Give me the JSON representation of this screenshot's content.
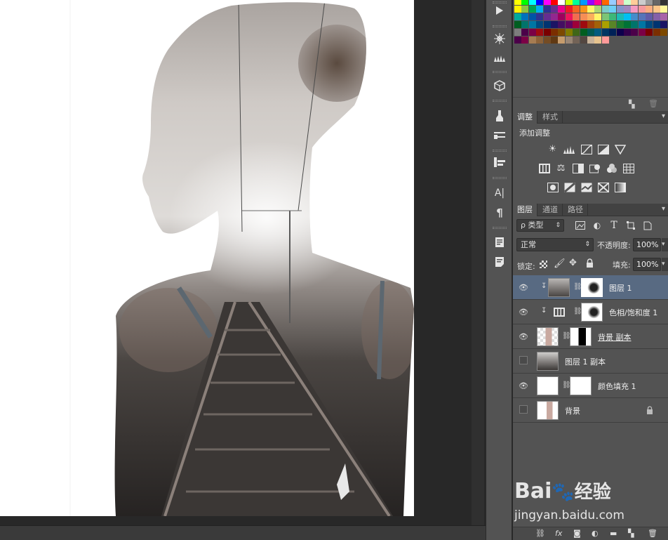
{
  "swatch_rows": [
    [
      "#ffff00",
      "#00ff00",
      "#00ffff",
      "#0000ff",
      "#ff00ff",
      "#ff0000",
      "#ffffff",
      "#ccff00",
      "#00ff99",
      "#0099ff",
      "#9900ff",
      "#ff0099",
      "#ff6600",
      "#99ccff",
      "#ff9999",
      "#ccffcc",
      "#ffcc99",
      "#cccccc",
      "#999999",
      "#666666",
      "#333333"
    ],
    [
      "#fff200",
      "#8dc63f",
      "#00a651",
      "#00aeef",
      "#2e3192",
      "#662d91",
      "#ec008c",
      "#ed1c24",
      "#f26522",
      "#f7941d",
      "#fff568",
      "#acd373",
      "#7accc8",
      "#6dcff6",
      "#8393ca",
      "#a186be",
      "#f49ac1",
      "#f5989d",
      "#f9ad81",
      "#fdc689",
      "#fff799"
    ],
    [
      "#00a99d",
      "#0072bc",
      "#0054a6",
      "#2e3192",
      "#662d91",
      "#92278f",
      "#9e005d",
      "#ed145b",
      "#f26c4f",
      "#f68e56",
      "#fbaf5d",
      "#fff467",
      "#7cc576",
      "#3cb878",
      "#1cbbb4",
      "#00bff3",
      "#448ccb",
      "#5674b9",
      "#605ca8",
      "#8560a8",
      "#a864a8"
    ],
    [
      "#005e20",
      "#00746b",
      "#0076a3",
      "#004a80",
      "#003471",
      "#1b1464",
      "#440e62",
      "#630460",
      "#9e0039",
      "#9e0b0f",
      "#a0410d",
      "#a36209",
      "#aba000",
      "#598527",
      "#197b30",
      "#007236",
      "#00746b",
      "#0076a3",
      "#004a80",
      "#003471",
      "#1b1464"
    ],
    [
      "#7d7d7d",
      "#4b0049",
      "#7b0046",
      "#9e0b0f",
      "#790000",
      "#7b2e00",
      "#7d4900",
      "#827b00",
      "#406618",
      "#005e20",
      "#005952",
      "#005b7f",
      "#003663",
      "#002157",
      "#0d004c",
      "#32004b",
      "#4b0049",
      "#7b0046",
      "#790000",
      "#7b2e00",
      "#7d4900"
    ],
    [
      "#4b0049",
      "#7b0046",
      "#a67c52",
      "#8c6239",
      "#754c24",
      "#603913",
      "#c69c6d",
      "#998675",
      "#736357",
      "#534741",
      "#c7b299",
      "#e6c38e",
      "#ff9999"
    ]
  ],
  "adjustments_panel": {
    "tabs": [
      "调整",
      "样式"
    ],
    "title": "添加调整"
  },
  "layers_panel": {
    "tabs": [
      "图层",
      "通道",
      "路径"
    ],
    "filter_label": "ρ 类型",
    "blend_mode": "正常",
    "opacity_label": "不透明度:",
    "opacity_value": "100%",
    "lock_label": "锁定:",
    "fill_label": "填充:",
    "fill_value": "100%",
    "layers": [
      {
        "name": "图层 1",
        "visible": true,
        "selected": true
      },
      {
        "name": "色相/饱和度 1",
        "visible": true,
        "selected": false
      },
      {
        "name": "背景 副本",
        "visible": true,
        "selected": false
      },
      {
        "name": "图层 1 副本",
        "visible": false,
        "selected": false
      },
      {
        "name": "颜色填充 1",
        "visible": true,
        "selected": false
      },
      {
        "name": "背景",
        "visible": false,
        "selected": false
      }
    ]
  },
  "watermark": {
    "brand": "Bai",
    "brand_tail": "经验",
    "url": "jingyan.baidu.com"
  }
}
